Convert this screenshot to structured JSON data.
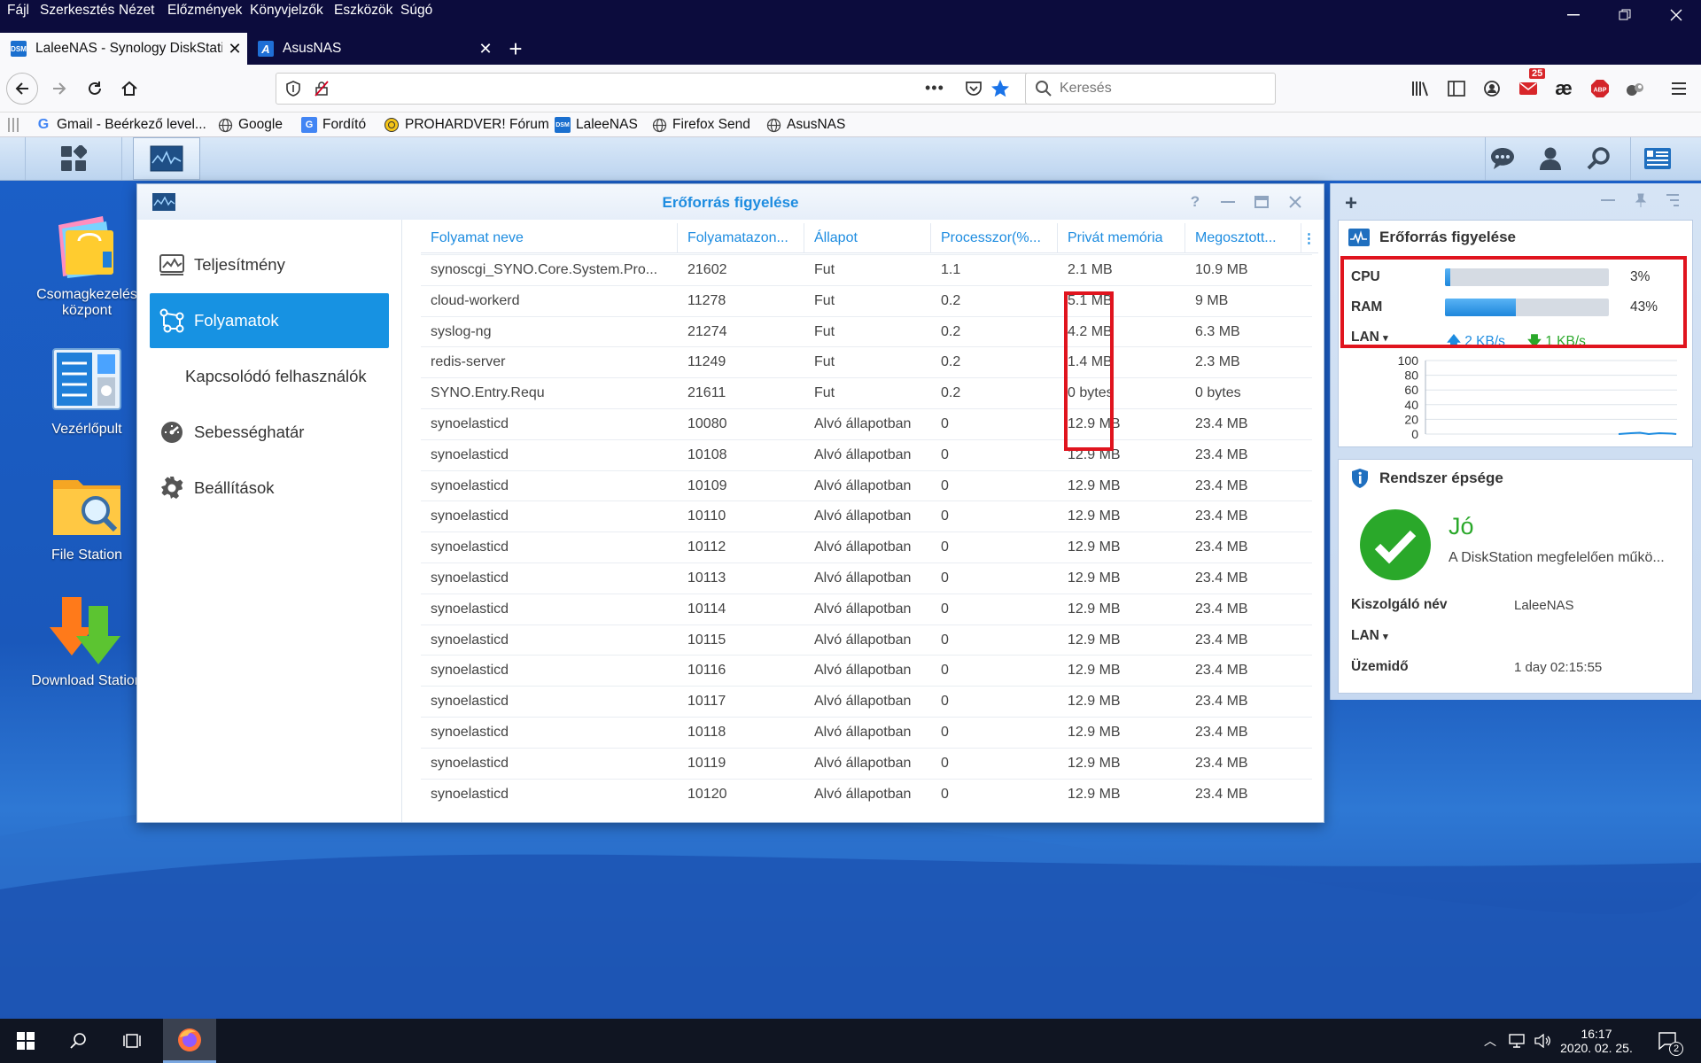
{
  "browser": {
    "menu": [
      "Fájl",
      "Szerkesztés",
      "Nézet",
      "Előzmények",
      "Könyvjelzők",
      "Eszközök",
      "Súgó"
    ],
    "tabs": [
      {
        "title": "LaleeNAS - Synology DiskStation",
        "favicon": "dsm-icon"
      },
      {
        "title": "AsusNAS",
        "favicon": "asus-icon"
      }
    ],
    "search_placeholder": "Keresés",
    "notification_count": "25",
    "bookmarks": [
      "Gmail - Beérkező level...",
      "Google",
      "Fordító",
      "PROHARDVER! Fórum",
      "LaleeNAS",
      "Firefox Send",
      "AsusNAS"
    ]
  },
  "desktop": {
    "icons": [
      "Csomagkezelés központ",
      "Vezérlőpult",
      "File Station",
      "Download Station"
    ]
  },
  "window": {
    "title": "Erőforrás figyelése",
    "sidebar": [
      {
        "label": "Teljesítmény",
        "icon": "performance-icon"
      },
      {
        "label": "Folyamatok",
        "icon": "process-icon"
      },
      {
        "label": "Kapcsolódó felhasználók",
        "icon": ""
      },
      {
        "label": "Sebességhatár",
        "icon": "speed-limit-icon"
      },
      {
        "label": "Beállítások",
        "icon": "gear-icon"
      }
    ],
    "columns": [
      "Folyamat neve",
      "Folyamatazon...",
      "Állapot",
      "Processzor(%...",
      "Privát memória",
      "Megosztott..."
    ],
    "rows": [
      [
        "synoscgi_SYNO.Core.System.Pro...",
        "21602",
        "Fut",
        "1.1",
        "2.1 MB",
        "10.9 MB"
      ],
      [
        "cloud-workerd",
        "11278",
        "Fut",
        "0.2",
        "5.1 MB",
        "9 MB"
      ],
      [
        "syslog-ng",
        "21274",
        "Fut",
        "0.2",
        "4.2 MB",
        "6.3 MB"
      ],
      [
        "redis-server",
        "11249",
        "Fut",
        "0.2",
        "1.4 MB",
        "2.3 MB"
      ],
      [
        "SYNO.Entry.Requ",
        "21611",
        "Fut",
        "0.2",
        "0 bytes",
        "0 bytes"
      ],
      [
        "synoelasticd",
        "10080",
        "Alvó állapotban",
        "0",
        "12.9 MB",
        "23.4 MB"
      ],
      [
        "synoelasticd",
        "10108",
        "Alvó állapotban",
        "0",
        "12.9 MB",
        "23.4 MB"
      ],
      [
        "synoelasticd",
        "10109",
        "Alvó állapotban",
        "0",
        "12.9 MB",
        "23.4 MB"
      ],
      [
        "synoelasticd",
        "10110",
        "Alvó állapotban",
        "0",
        "12.9 MB",
        "23.4 MB"
      ],
      [
        "synoelasticd",
        "10112",
        "Alvó állapotban",
        "0",
        "12.9 MB",
        "23.4 MB"
      ],
      [
        "synoelasticd",
        "10113",
        "Alvó állapotban",
        "0",
        "12.9 MB",
        "23.4 MB"
      ],
      [
        "synoelasticd",
        "10114",
        "Alvó állapotban",
        "0",
        "12.9 MB",
        "23.4 MB"
      ],
      [
        "synoelasticd",
        "10115",
        "Alvó állapotban",
        "0",
        "12.9 MB",
        "23.4 MB"
      ],
      [
        "synoelasticd",
        "10116",
        "Alvó állapotban",
        "0",
        "12.9 MB",
        "23.4 MB"
      ],
      [
        "synoelasticd",
        "10117",
        "Alvó állapotban",
        "0",
        "12.9 MB",
        "23.4 MB"
      ],
      [
        "synoelasticd",
        "10118",
        "Alvó állapotban",
        "0",
        "12.9 MB",
        "23.4 MB"
      ],
      [
        "synoelasticd",
        "10119",
        "Alvó állapotban",
        "0",
        "12.9 MB",
        "23.4 MB"
      ],
      [
        "synoelasticd",
        "10120",
        "Alvó állapotban",
        "0",
        "12.9 MB",
        "23.4 MB"
      ]
    ]
  },
  "widget_resource": {
    "title": "Erőforrás figyelése",
    "cpu_label": "CPU",
    "cpu_value": "3%",
    "cpu_fraction": 0.03,
    "ram_label": "RAM",
    "ram_value": "43%",
    "ram_fraction": 0.43,
    "lan_label": "LAN",
    "upload": "2 KB/s",
    "download": "1 KB/s",
    "chart_ticks": [
      "100",
      "80",
      "60",
      "40",
      "20",
      "0"
    ]
  },
  "widget_health": {
    "title": "Rendszer épsége",
    "status": "Jó",
    "message": "A DiskStation megfelelően műkö...",
    "server_label": "Kiszolgáló név",
    "server_value": "LaleeNAS",
    "lan_label": "LAN",
    "uptime_label": "Üzemidő",
    "uptime_value": "1 day 02:15:55"
  },
  "taskbar": {
    "time": "16:17",
    "date": "2020. 02. 25.",
    "notifications": "2"
  },
  "colors": {
    "accent": "#1792e2",
    "highlight": "#e0141e",
    "ok": "#2aa82a"
  }
}
